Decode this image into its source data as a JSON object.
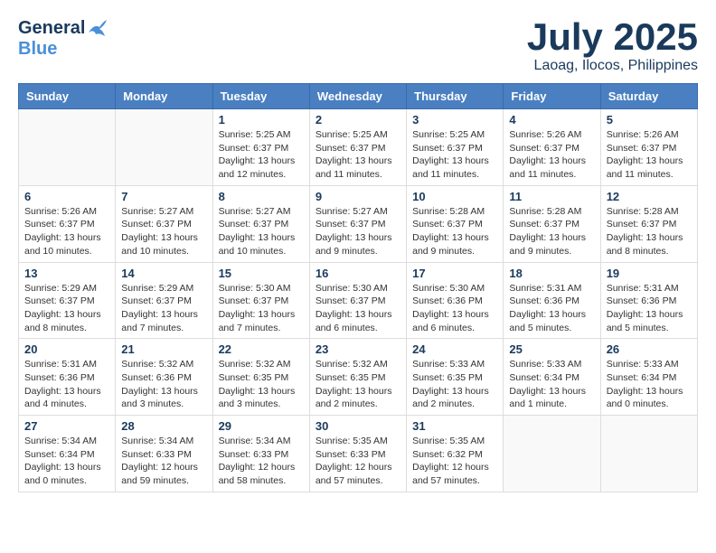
{
  "header": {
    "logo_general": "General",
    "logo_blue": "Blue",
    "month": "July 2025",
    "location": "Laoag, Ilocos, Philippines"
  },
  "weekdays": [
    "Sunday",
    "Monday",
    "Tuesday",
    "Wednesday",
    "Thursday",
    "Friday",
    "Saturday"
  ],
  "weeks": [
    [
      {
        "day": "",
        "info": ""
      },
      {
        "day": "",
        "info": ""
      },
      {
        "day": "1",
        "info": "Sunrise: 5:25 AM\nSunset: 6:37 PM\nDaylight: 13 hours and 12 minutes."
      },
      {
        "day": "2",
        "info": "Sunrise: 5:25 AM\nSunset: 6:37 PM\nDaylight: 13 hours and 11 minutes."
      },
      {
        "day": "3",
        "info": "Sunrise: 5:25 AM\nSunset: 6:37 PM\nDaylight: 13 hours and 11 minutes."
      },
      {
        "day": "4",
        "info": "Sunrise: 5:26 AM\nSunset: 6:37 PM\nDaylight: 13 hours and 11 minutes."
      },
      {
        "day": "5",
        "info": "Sunrise: 5:26 AM\nSunset: 6:37 PM\nDaylight: 13 hours and 11 minutes."
      }
    ],
    [
      {
        "day": "6",
        "info": "Sunrise: 5:26 AM\nSunset: 6:37 PM\nDaylight: 13 hours and 10 minutes."
      },
      {
        "day": "7",
        "info": "Sunrise: 5:27 AM\nSunset: 6:37 PM\nDaylight: 13 hours and 10 minutes."
      },
      {
        "day": "8",
        "info": "Sunrise: 5:27 AM\nSunset: 6:37 PM\nDaylight: 13 hours and 10 minutes."
      },
      {
        "day": "9",
        "info": "Sunrise: 5:27 AM\nSunset: 6:37 PM\nDaylight: 13 hours and 9 minutes."
      },
      {
        "day": "10",
        "info": "Sunrise: 5:28 AM\nSunset: 6:37 PM\nDaylight: 13 hours and 9 minutes."
      },
      {
        "day": "11",
        "info": "Sunrise: 5:28 AM\nSunset: 6:37 PM\nDaylight: 13 hours and 9 minutes."
      },
      {
        "day": "12",
        "info": "Sunrise: 5:28 AM\nSunset: 6:37 PM\nDaylight: 13 hours and 8 minutes."
      }
    ],
    [
      {
        "day": "13",
        "info": "Sunrise: 5:29 AM\nSunset: 6:37 PM\nDaylight: 13 hours and 8 minutes."
      },
      {
        "day": "14",
        "info": "Sunrise: 5:29 AM\nSunset: 6:37 PM\nDaylight: 13 hours and 7 minutes."
      },
      {
        "day": "15",
        "info": "Sunrise: 5:30 AM\nSunset: 6:37 PM\nDaylight: 13 hours and 7 minutes."
      },
      {
        "day": "16",
        "info": "Sunrise: 5:30 AM\nSunset: 6:37 PM\nDaylight: 13 hours and 6 minutes."
      },
      {
        "day": "17",
        "info": "Sunrise: 5:30 AM\nSunset: 6:36 PM\nDaylight: 13 hours and 6 minutes."
      },
      {
        "day": "18",
        "info": "Sunrise: 5:31 AM\nSunset: 6:36 PM\nDaylight: 13 hours and 5 minutes."
      },
      {
        "day": "19",
        "info": "Sunrise: 5:31 AM\nSunset: 6:36 PM\nDaylight: 13 hours and 5 minutes."
      }
    ],
    [
      {
        "day": "20",
        "info": "Sunrise: 5:31 AM\nSunset: 6:36 PM\nDaylight: 13 hours and 4 minutes."
      },
      {
        "day": "21",
        "info": "Sunrise: 5:32 AM\nSunset: 6:36 PM\nDaylight: 13 hours and 3 minutes."
      },
      {
        "day": "22",
        "info": "Sunrise: 5:32 AM\nSunset: 6:35 PM\nDaylight: 13 hours and 3 minutes."
      },
      {
        "day": "23",
        "info": "Sunrise: 5:32 AM\nSunset: 6:35 PM\nDaylight: 13 hours and 2 minutes."
      },
      {
        "day": "24",
        "info": "Sunrise: 5:33 AM\nSunset: 6:35 PM\nDaylight: 13 hours and 2 minutes."
      },
      {
        "day": "25",
        "info": "Sunrise: 5:33 AM\nSunset: 6:34 PM\nDaylight: 13 hours and 1 minute."
      },
      {
        "day": "26",
        "info": "Sunrise: 5:33 AM\nSunset: 6:34 PM\nDaylight: 13 hours and 0 minutes."
      }
    ],
    [
      {
        "day": "27",
        "info": "Sunrise: 5:34 AM\nSunset: 6:34 PM\nDaylight: 13 hours and 0 minutes."
      },
      {
        "day": "28",
        "info": "Sunrise: 5:34 AM\nSunset: 6:33 PM\nDaylight: 12 hours and 59 minutes."
      },
      {
        "day": "29",
        "info": "Sunrise: 5:34 AM\nSunset: 6:33 PM\nDaylight: 12 hours and 58 minutes."
      },
      {
        "day": "30",
        "info": "Sunrise: 5:35 AM\nSunset: 6:33 PM\nDaylight: 12 hours and 57 minutes."
      },
      {
        "day": "31",
        "info": "Sunrise: 5:35 AM\nSunset: 6:32 PM\nDaylight: 12 hours and 57 minutes."
      },
      {
        "day": "",
        "info": ""
      },
      {
        "day": "",
        "info": ""
      }
    ]
  ]
}
